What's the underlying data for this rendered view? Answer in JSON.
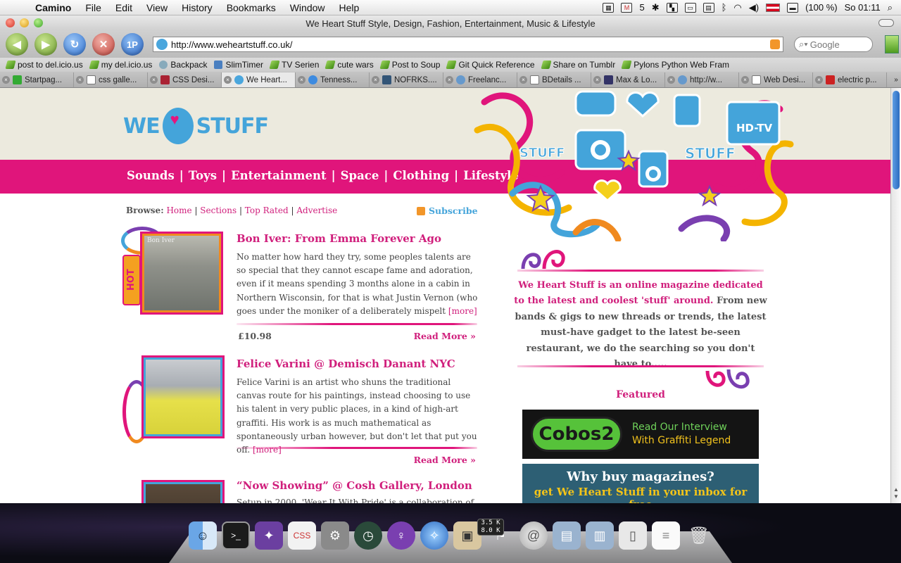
{
  "menubar": {
    "app": "Camino",
    "menus": [
      "File",
      "Edit",
      "View",
      "History",
      "Bookmarks",
      "Window",
      "Help"
    ],
    "mail_count": "5",
    "battery": "(100 %)",
    "clock": "So 01:11"
  },
  "window": {
    "title": "We Heart Stuff Style, Design, Fashion, Entertainment, Music & Lifestyle"
  },
  "toolbar": {
    "url": "http://www.weheartstuff.co.uk/",
    "search_placeholder": "Google",
    "btn_1p": "1P"
  },
  "bookmarks": [
    "post to del.icio.us",
    "my del.icio.us",
    "Backpack",
    "SlimTimer",
    "TV Serien",
    "cute wars",
    "Post to Soup",
    "Git Quick Reference",
    "Share on Tumblr",
    "Pylons Python Web Fram"
  ],
  "tabs": [
    "Startpag...",
    "css galle...",
    "CSS Desi...",
    "We Heart...",
    "Tenness...",
    "NOFRKS....",
    "Freelanc...",
    "BDetails ...",
    "Max & Lo...",
    "http://w...",
    "Web Desi...",
    "electric p..."
  ],
  "site": {
    "logo_left": "WE",
    "logo_right": "STUFF",
    "nav": [
      "Sounds",
      "Toys",
      "Entertainment",
      "Space",
      "Clothing",
      "Lifestyle"
    ],
    "nav_sep": "|",
    "browse_label": "Browse:",
    "browse_links": [
      "Home",
      "Sections",
      "Top Rated",
      "Advertise"
    ],
    "subscribe": "Subscribe",
    "art_labels": {
      "tv": "HD-TV",
      "left": "STUFF",
      "right": "STUFF"
    },
    "hot_badge": "HOT",
    "articles": [
      {
        "title": "Bon Iver: From Emma Forever Ago",
        "body": "No matter how hard they try, some peoples talents are so special that they cannot escape fame and adoration, even if it means spending 3 months alone in a cabin in Northern Wisconsin, for that is what Justin Vernon (who goes under the moniker of a deliberately mispelt",
        "more": "[more]",
        "price": "£10.98",
        "read_more": "Read More »",
        "thumb_label": "Bon Iver"
      },
      {
        "title": "Felice Varini @ Demisch Danant NYC",
        "body": "Felice Varini is an artist who shuns the traditional canvas route for his paintings, instead choosing to use his talent in very public places, in a kind of high-art graffiti. His work is as much mathematical as spontaneously urban however, but don't let that put you off.",
        "more": "[more]",
        "read_more": "Read More »"
      },
      {
        "title": "“Now Showing” @ Cosh Gallery, London",
        "body": "Setup in 2000, 'Wear It With Pride' is a collaboration of"
      }
    ],
    "intro_highlight": "We Heart Stuff is an online magazine dedicated to the latest and coolest 'stuff' around.",
    "intro_rest": "From new bands & gigs to new threads or trends, the latest must-have gadget to the latest be-seen restaurant, we do the searching so you don't have to.....",
    "featured": "Featured",
    "banner1": {
      "logo": "Cobos2",
      "line1": "Read Our Interview",
      "line2": "With Graffiti Legend"
    },
    "banner2": {
      "line1": "Why buy magazines?",
      "line2": "get We Heart Stuff in your inbox for free"
    }
  },
  "dock": {
    "net_up": "3.5 K",
    "net_down": "8.0 K"
  },
  "colors": {
    "brand_pink": "#e0157b",
    "brand_blue": "#44a4da",
    "header_beige": "#eceade"
  }
}
